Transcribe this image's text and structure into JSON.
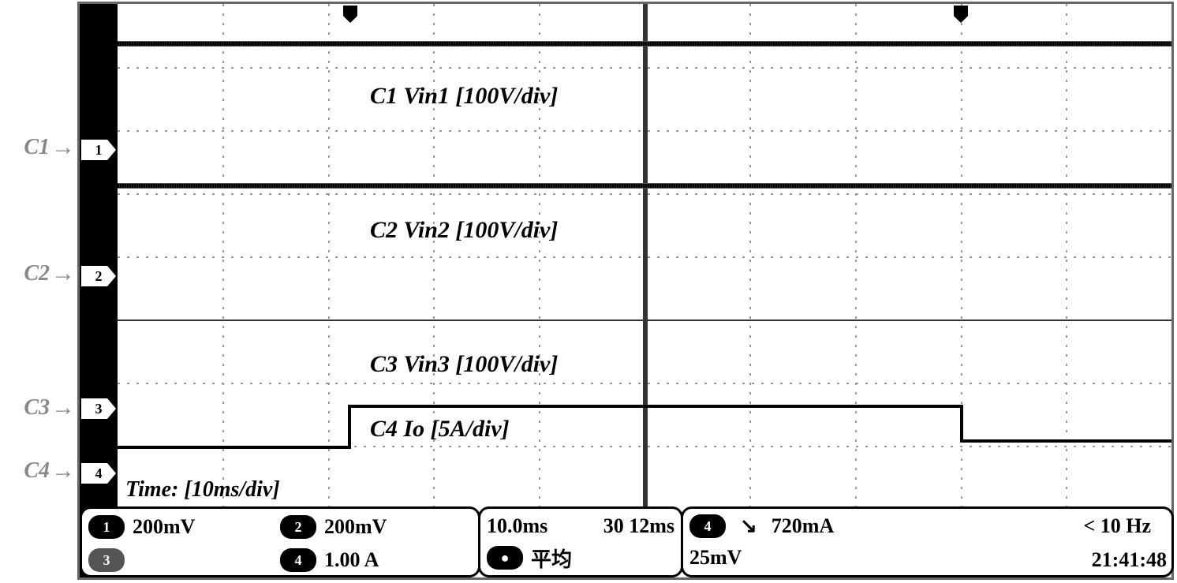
{
  "channel_outer_labels": [
    "C1",
    "C2",
    "C3",
    "C4"
  ],
  "annotations": {
    "c1": "C1 Vin1 [100V/div]",
    "c2": "C2 Vin2 [100V/div]",
    "c3": "C3 Vin3 [100V/div]",
    "c4": "C4  Io    [5A/div]",
    "time": "Time: [10ms/div]"
  },
  "status": {
    "ch1_badge": "1",
    "ch1_scale": "200mV",
    "ch2_badge": "2",
    "ch2_scale": "200mV",
    "ch3_badge": "3",
    "ch3_scale": "",
    "ch4_badge": "4",
    "ch4_scale": "1.00 A",
    "timebase": "10.0ms",
    "timebase2": "30  12ms",
    "trig_badge": "4",
    "trig_slope": "↘",
    "trig_level": "720mA",
    "trig_freq": "< 10 Hz",
    "avg_badge": "●",
    "avg_label": "平均",
    "avg_value": "25mV"
  },
  "clock": "21:41:48",
  "gnd_markers": [
    "1",
    "2",
    "3",
    "4"
  ],
  "chart_data": {
    "type": "line",
    "timebase_per_div": "10ms",
    "horizontal_divisions": 10,
    "vertical_divisions": 8,
    "channels": [
      {
        "name": "C1 Vin1",
        "scale": "100V/div",
        "ground_div_from_top": 2.3,
        "trace_level_div_from_top": 0.6,
        "value_estimate_V": 170,
        "shape": "flat"
      },
      {
        "name": "C2 Vin2",
        "scale": "100V/div",
        "ground_div_from_top": 4.3,
        "trace_level_div_from_top": 2.85,
        "value_estimate_V": 145,
        "shape": "flat"
      },
      {
        "name": "C3 Vin3",
        "scale": "100V/div",
        "ground_div_from_top": 6.4,
        "trace_level_div_from_top": 5.0,
        "value_estimate_V": 140,
        "shape": "flat"
      },
      {
        "name": "C4 Io",
        "scale": "5A/div",
        "ground_div_from_top": 7.4,
        "shape": "step",
        "segments": [
          {
            "t_start_div": 0.0,
            "t_end_div": 2.2,
            "level_div_from_top": 7.0,
            "value_estimate_A": 2
          },
          {
            "t_start_div": 2.2,
            "t_end_div": 8.0,
            "level_div_from_top": 6.35,
            "value_estimate_A": 5.3
          },
          {
            "t_start_div": 8.0,
            "t_end_div": 10.0,
            "level_div_from_top": 6.9,
            "value_estimate_A": 2.5
          }
        ]
      }
    ],
    "trigger_markers_div_from_left": [
      2.2,
      8.0
    ]
  }
}
